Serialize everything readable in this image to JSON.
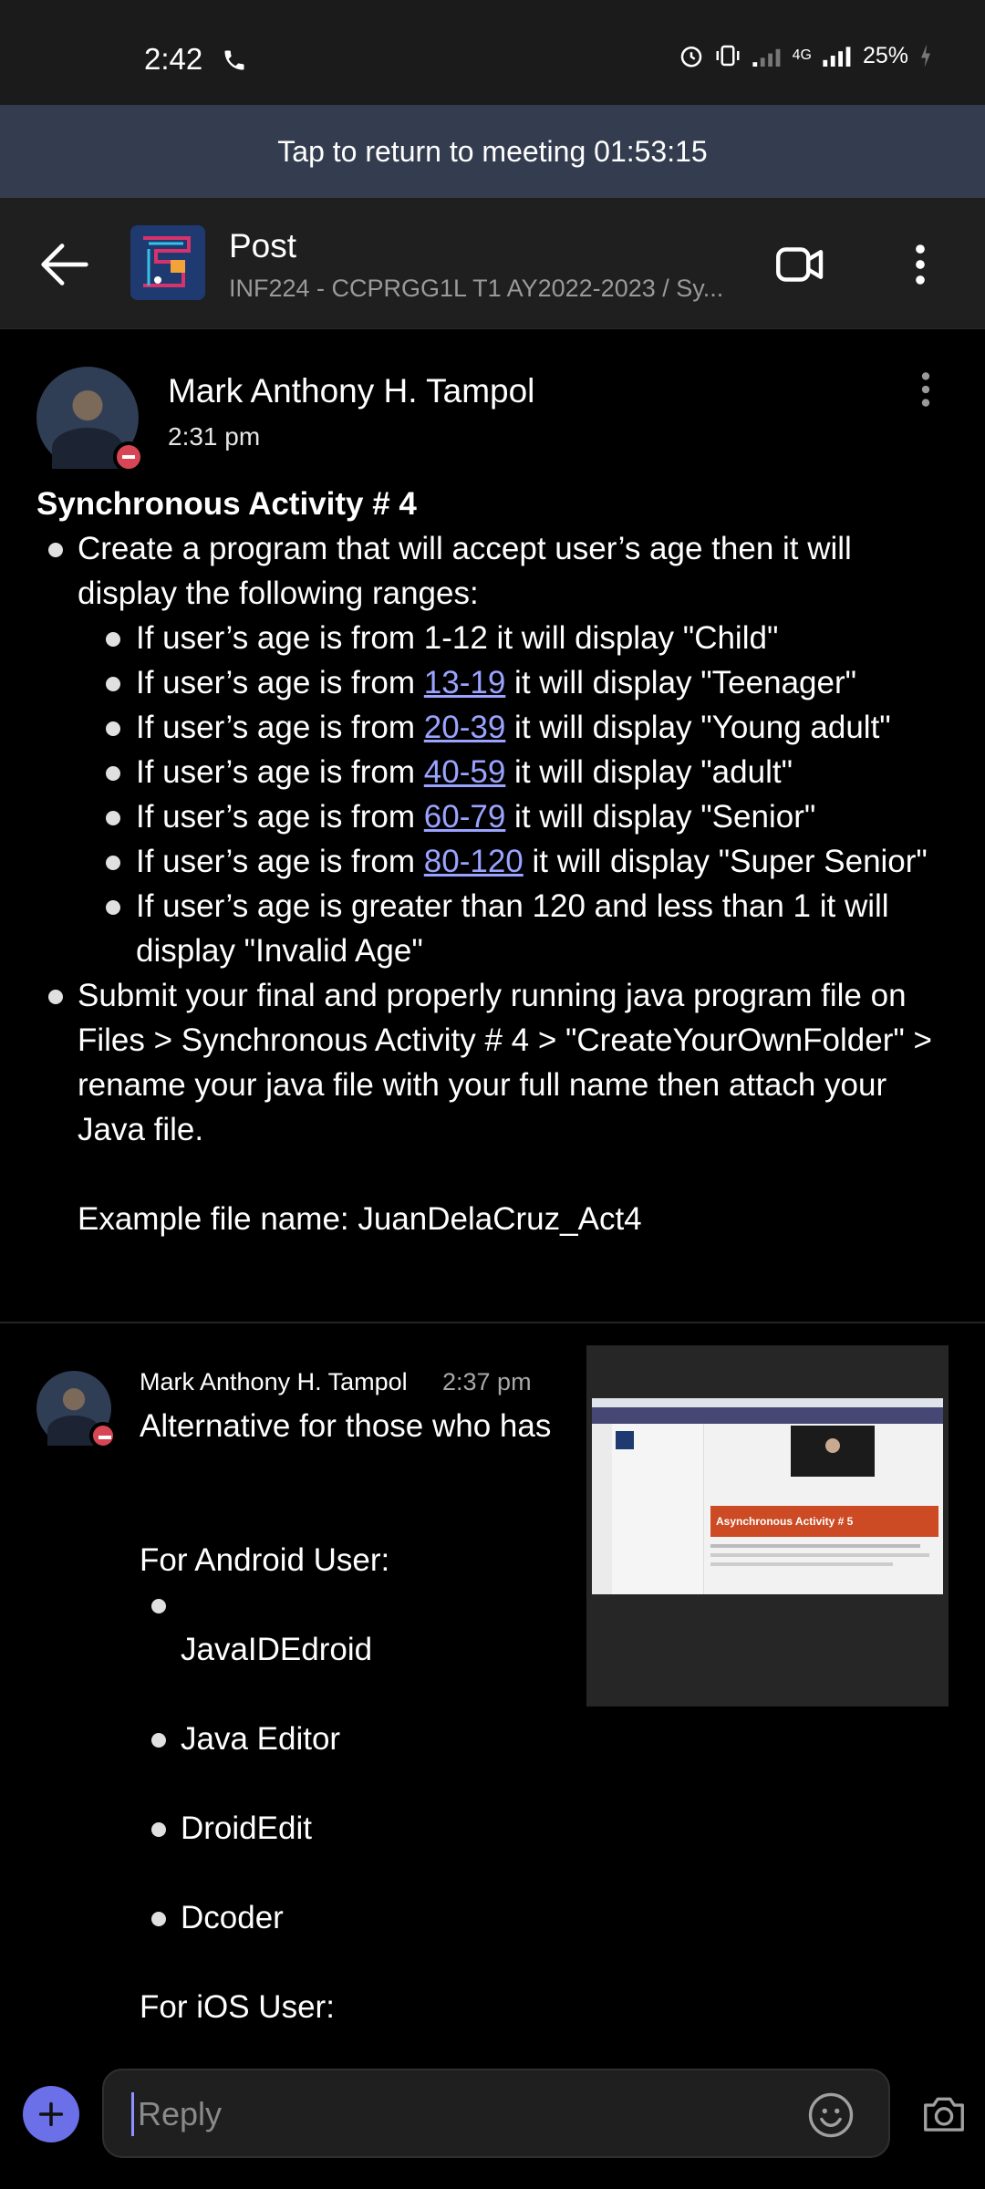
{
  "status_bar": {
    "time": "2:42",
    "battery": "25%",
    "network": "4G"
  },
  "banner": {
    "text": "Tap to return to meeting 01:53:15"
  },
  "header": {
    "title": "Post",
    "subtitle": "INF224 - CCPRGG1L T1 AY2022-2023 / Sy..."
  },
  "post": {
    "author": "Mark Anthony H. Tampol",
    "time": "2:31 pm",
    "heading": "Synchronous Activity # 4",
    "item1": "Create a program that will accept user’s age then it will display the following ranges:",
    "sub": [
      {
        "pre": "If user’s age is from 1-12 it will display \"Child\"",
        "link": "",
        "post": ""
      },
      {
        "pre": "If user’s age is from ",
        "link": "13-19",
        "post": " it will display \"Teenager\""
      },
      {
        "pre": "If user’s age is from ",
        "link": "20-39",
        "post": " it will display \"Young adult\""
      },
      {
        "pre": "If user’s age is from ",
        "link": "40-59",
        "post": " it will display \"adult\""
      },
      {
        "pre": "If user’s age is from ",
        "link": "60-79",
        "post": " it will display \"Senior\""
      },
      {
        "pre": "If user’s age is from ",
        "link": "80-120",
        "post": " it will display \"Super Senior\""
      },
      {
        "pre": "If user’s age is greater than 120 and less than 1 it will display \"Invalid Age\"",
        "link": "",
        "post": ""
      }
    ],
    "item2": "Submit your final and properly running java program file on Files > Synchronous Activity # 4 > \"CreateYourOwnFolder\" > rename your java file with your full name then attach your Java file.",
    "example": "Example file name: JuanDelaCruz_Act4"
  },
  "reply": {
    "author": "Mark Anthony H. Tampol",
    "time": "2:37 pm",
    "text": "Alternative for those who has",
    "android_heading": "For Android User:",
    "android_apps": [
      "JavaIDEdroid",
      "Java Editor",
      "DroidEdit",
      "Dcoder"
    ],
    "ios_heading": "For iOS User:",
    "thumbnail_title": "Asynchronous Activity # 5"
  },
  "composer": {
    "placeholder": "Reply"
  },
  "colors": {
    "accent": "#6b6fe8",
    "link": "#9aa3ff",
    "banner": "#343d4f",
    "presence_busy": "#d74654"
  }
}
